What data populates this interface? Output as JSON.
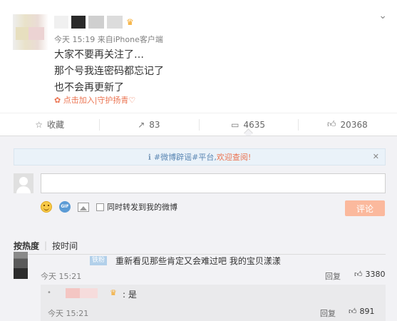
{
  "post": {
    "timestamp": "今天 15:19",
    "source": "来自iPhone客户端",
    "lines": [
      "大家不要再关注了…",
      "那个号我连密码都忘记了",
      "也不会再更新了"
    ],
    "support_text": "点击加入|守护扬青♡"
  },
  "actions": {
    "favorite_label": "收藏",
    "repost_count": "83",
    "comment_count": "4635",
    "like_count": "20368"
  },
  "comments": {
    "notice_prefix": "#微博辟谣#平台,",
    "notice_link": "欢迎查阅!",
    "repost_option_label": "同时转发到我的微博",
    "submit_label": "评论",
    "sort_hot": "按热度",
    "sort_time": "按时间",
    "items": [
      {
        "badge": "铁粉",
        "text": "重新看见那些肯定又会难过吧 我的宝贝漾漾",
        "time": "今天 15:21",
        "reply_label": "回复",
        "likes": "3380",
        "reply": {
          "text": ": 是",
          "time": "今天 15:21",
          "reply_label": "回复",
          "likes": "891"
        }
      }
    ]
  },
  "colors": {
    "accent": "#eb7350",
    "link_blue": "#5b87b4",
    "submit_bg": "#fbb99d"
  }
}
